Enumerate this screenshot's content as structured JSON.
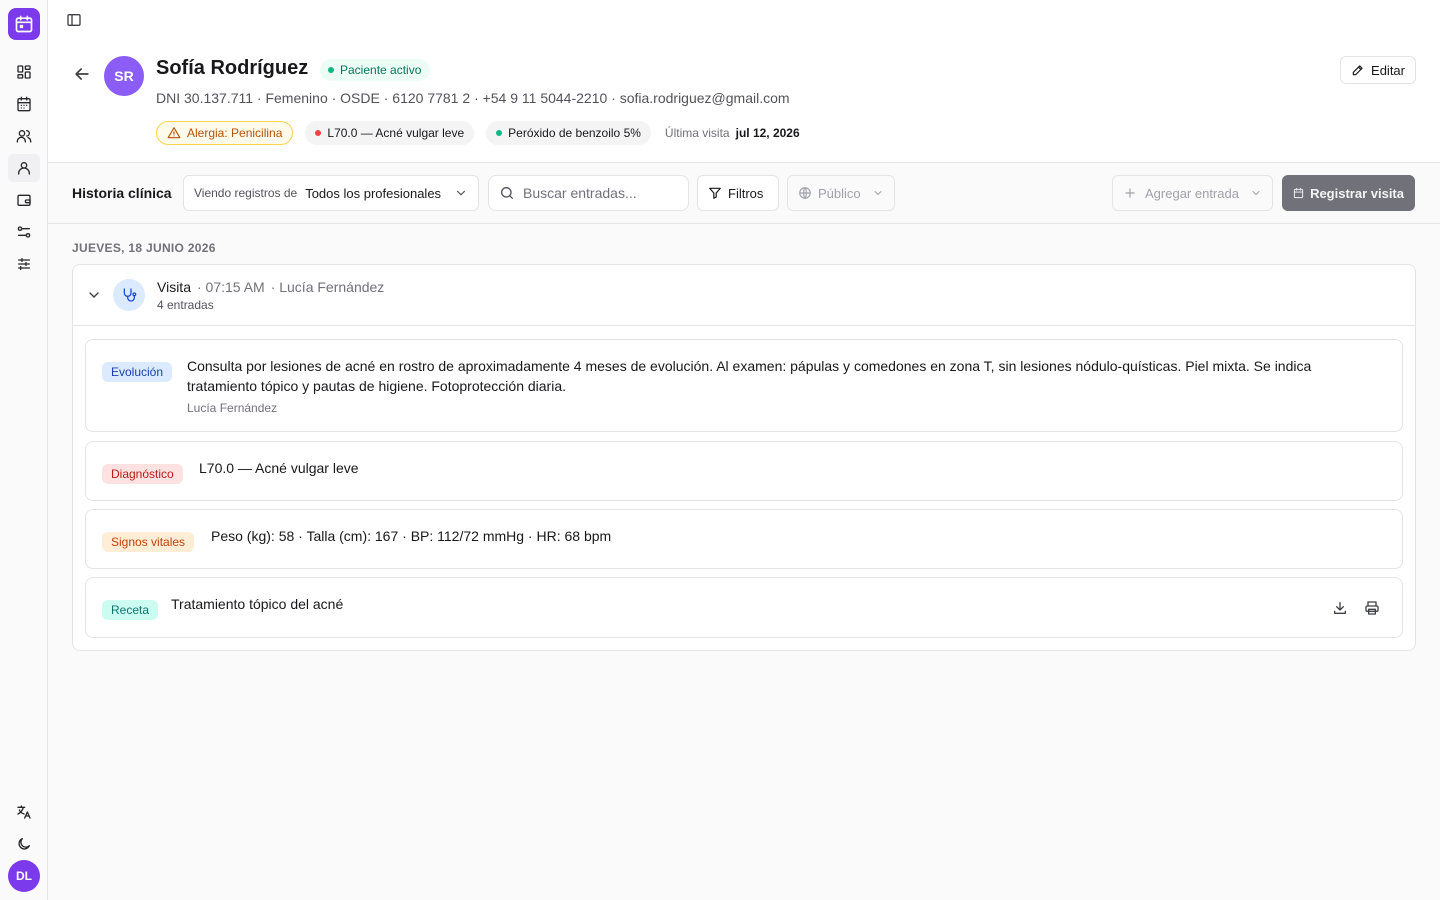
{
  "sidebar": {
    "user_initials": "DL",
    "items": [
      {
        "name": "dashboard-icon"
      },
      {
        "name": "calendar-icon"
      },
      {
        "name": "users-icon"
      },
      {
        "name": "user-icon"
      },
      {
        "name": "wallet-icon"
      },
      {
        "name": "workflow-icon"
      },
      {
        "name": "sliders-icon"
      }
    ],
    "bottom": [
      {
        "name": "language-icon"
      },
      {
        "name": "moon-icon"
      }
    ]
  },
  "patient": {
    "initials": "SR",
    "name": "Sofía Rodríguez",
    "status": "Paciente activo",
    "meta": "DNI 30.137.711 · Femenino · OSDE · 6120 7781 2 · +54 9 11 5044-2210 · sofia.rodriguez@gmail.com",
    "allergy": "Alergia: Penicilina",
    "diagnosis_chip": "L70.0 — Acné vulgar leve",
    "medication_chip": "Peróxido de benzoilo 5%",
    "last_visit_label": "Última visita",
    "last_visit_value": "jul 12, 2026",
    "edit_label": "Editar"
  },
  "toolbar": {
    "title": "Historia clínica",
    "viewing_label": "Viendo registros de",
    "viewing_value": "Todos los profesionales",
    "search_placeholder": "Buscar entradas...",
    "filters_label": "Filtros",
    "visibility_label": "Público",
    "add_entry_label": "Agregar entrada",
    "register_visit_label": "Registrar visita"
  },
  "timeline": {
    "date_label": "JUEVES, 18 JUNIO 2026",
    "visit": {
      "type": "Visita",
      "time": "· 07:15 AM",
      "professional": "· Lucía Fernández",
      "count": "4 entradas",
      "entries": [
        {
          "tag": "Evolución",
          "text": "Consulta por lesiones de acné en rostro de aproximadamente 4 meses de evolución. Al examen: pápulas y comedones en zona T, sin lesiones nódulo-quísticas. Piel mixta. Se indica tratamiento tópico y pautas de higiene. Fotoprotección diaria.",
          "author": "Lucía Fernández"
        },
        {
          "tag": "Diagnóstico",
          "text": "L70.0 — Acné vulgar leve"
        },
        {
          "tag": "Signos vitales",
          "text": "Peso (kg): 58 · Talla (cm): 167 · BP: 112/72 mmHg · HR: 68 bpm"
        },
        {
          "tag": "Receta",
          "text": "Tratamiento tópico del acné"
        }
      ]
    }
  },
  "colors": {
    "brand": "#7c3aed",
    "active_green": "#10b981",
    "diagnosis_red": "#ef4444",
    "medication_teal": "#10b981"
  }
}
